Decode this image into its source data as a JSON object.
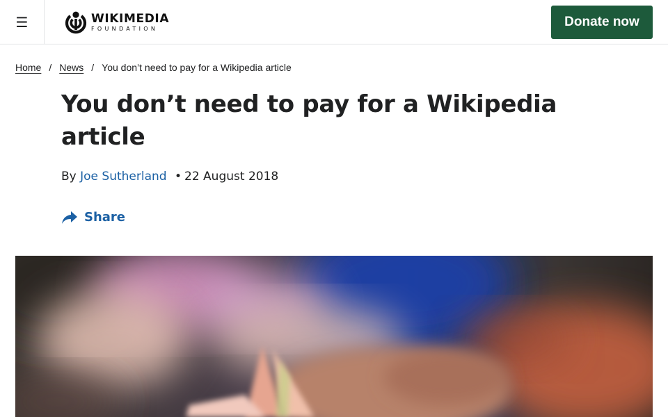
{
  "header": {
    "menu_glyph": "☰",
    "logo": {
      "title": "WIKIMEDIA",
      "subtitle": "FOUNDATION",
      "icon": "wikimedia-logo-icon"
    },
    "donate_label": "Donate now",
    "donate_color": "#1d5a3b"
  },
  "breadcrumb": {
    "items": [
      "Home",
      "News"
    ],
    "separator": "/",
    "current": "You don’t need to pay for a Wikipedia article"
  },
  "article": {
    "title": "You don’t need to pay for a Wikipedia article",
    "byline_prefix": "By",
    "author": "Joe Sutherland",
    "date_separator": "•",
    "date": "22 August 2018",
    "link_color": "#1b60a4",
    "share_label": "Share",
    "share_icon": "share-arrow-icon",
    "hero_image": "blurred photo of hands holding folded banknotes"
  }
}
